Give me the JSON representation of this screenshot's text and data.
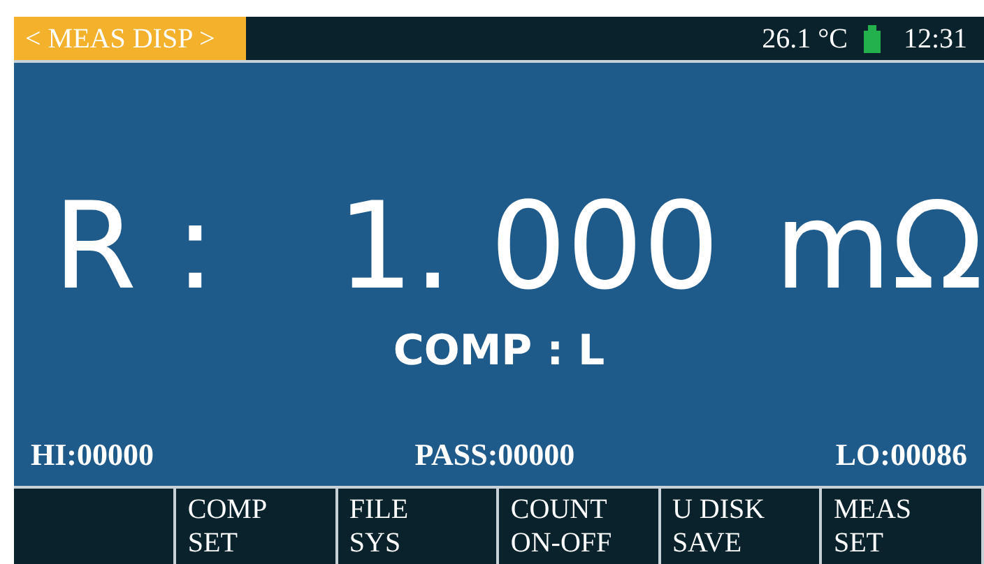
{
  "header": {
    "title": "< MEAS DISP >",
    "temperature": "26.1 °C",
    "battery": {
      "color": "#22b14c"
    },
    "time": "12:31"
  },
  "reading": {
    "parameter": "R :",
    "value": "1. 000",
    "unit": "mΩ",
    "comparison": "COMP : L"
  },
  "counters": [
    {
      "label": "HI:00000"
    },
    {
      "label": "PASS:00000"
    },
    {
      "label": "LO:00086"
    }
  ],
  "softkeys": [
    {
      "label": "COMP\nSET"
    },
    {
      "label": "FILE\nSYS"
    },
    {
      "label": "COUNT\nON-OFF"
    },
    {
      "label": "U DISK\nSAVE"
    },
    {
      "label": "MEAS\nSET"
    }
  ]
}
